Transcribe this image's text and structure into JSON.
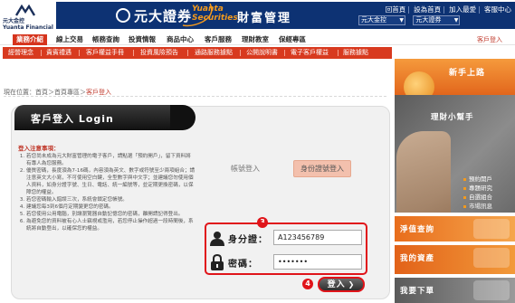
{
  "header": {
    "logo_small_cn": "元大金控",
    "logo_small_en": "Yuanta Financial",
    "brand_cn": "元大證券",
    "brand_en_line1": "Yuanta",
    "brand_en_line2": "Securities",
    "section_title": "財富管理",
    "links": [
      "回首頁",
      "設為首頁",
      "加入最愛",
      "客服中心"
    ],
    "select_group": "元大金控",
    "select_company": "元大證券"
  },
  "nav_main": {
    "items": [
      "業務介紹",
      "線上交易",
      "帳務查詢",
      "投資情報",
      "商品中心",
      "客戶服務",
      "理財教室",
      "保經專區"
    ],
    "active_index": 0,
    "right_link": "客戶登入"
  },
  "nav_sub": {
    "items": [
      "經營理念",
      "貴賓禮遇",
      "客戶權益手冊",
      "投資風險預告",
      "通路服務據點",
      "公開說明書",
      "電子客戶權益",
      "服務據點"
    ]
  },
  "breadcrumb": {
    "prefix": "現在位置：",
    "items": [
      "首頁",
      "首頁專區"
    ],
    "current": "客戶登入",
    "separator": "＞"
  },
  "login": {
    "title": "客戶登入 Login",
    "notes_heading": "登入注意事項：",
    "notes": [
      "若您尚未成為元大財富管理的電子客戶，請點選「預約開戶」，留下資料將有專人為您服務。",
      "優質密碼，長度須為7-16碼，內容須為英文、數字或符號至少兩項組合；請注意英文大小寫，不可使用空白鍵，全型數字與中文字；並建議您勿使用個人資料，如身分證字號、生日、電話、統一編號等，並定期更換密碼，以保障您的權益。",
      "若您密碼輸入錯誤三次，系統會鎖定您帳號。",
      "建議您每3到6個月定期變更您的密碼。",
      "若您使用公用電腦，別讓瀏覽器自動記憶您的密碼，離開請記得登出。",
      "為避免您的資料被有心人士竊視或濫用，若您停止操作超過一段時間後，系統將自動登出，以確保您的權益。"
    ],
    "tab_account": "帳號登入",
    "tab_id": "身份證號登入",
    "id_label": "身分證：",
    "id_value": "A123456789",
    "password_label": "密碼：",
    "password_value": "•••••••",
    "badge_fields": "3",
    "badge_button": "4",
    "login_button": "登入"
  },
  "sidebar": {
    "newbie": "新手上路",
    "helper_title": "理財小幫手",
    "helper_links": [
      "預約開戶",
      "專題研究",
      "自選組合",
      "市場訊息"
    ],
    "net_value": "淨值查詢",
    "my_assets": "我的資產",
    "my_order": "我要下單"
  },
  "colors": {
    "brand_navy": "#0d3273",
    "brand_orange": "#f39a1e",
    "accent_red": "#d83a1f",
    "highlight_red": "#e0141a"
  }
}
